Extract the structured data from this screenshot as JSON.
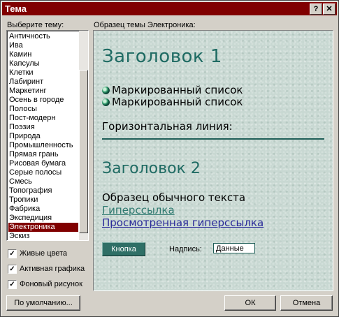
{
  "window": {
    "title": "Тема",
    "help_button": "?",
    "close_button": "✕"
  },
  "theme_list": {
    "label": "Выберите тему:",
    "items": [
      "Античность",
      "Ива",
      "Камин",
      "Капсулы",
      "Клетки",
      "Лабиринт",
      "Маркетинг",
      "Осень в городе",
      "Полосы",
      "Пост-модерн",
      "Поэзия",
      "Природа",
      "Промышленность",
      "Прямая грань",
      "Рисовая бумага",
      "Серые полосы",
      "Смесь",
      "Топография",
      "Тропики",
      "Фабрика",
      "Экспедиция",
      "Электроника",
      "Эскиз"
    ],
    "selected": "Электроника"
  },
  "options": {
    "vivid_colors": {
      "label": "Живые цвета",
      "checked": true
    },
    "active_graphics": {
      "label": "Активная графика",
      "checked": true
    },
    "background_image": {
      "label": "Фоновый рисунок",
      "checked": true
    }
  },
  "preview": {
    "label": "Образец темы Электроника:",
    "heading1": "Заголовок 1",
    "bullet1": "Маркированный список",
    "bullet2": "Маркированный список",
    "hr_label": "Горизонтальная линия:",
    "heading2": "Заголовок 2",
    "normal_text": "Образец обычного текста",
    "hyperlink": "Гиперссылка",
    "visited_hyperlink": "Просмотренная гиперссылка",
    "button_label": "Кнопка",
    "field_label": "Надпись:",
    "field_value": "Данные"
  },
  "buttons": {
    "default": "По умолчанию...",
    "ok": "ОК",
    "cancel": "Отмена"
  },
  "colors": {
    "titlebar": "#800000",
    "selection": "#800000",
    "heading": "#1f6b63",
    "link": "#1f6b63",
    "visited_link": "#2a2a9a"
  }
}
